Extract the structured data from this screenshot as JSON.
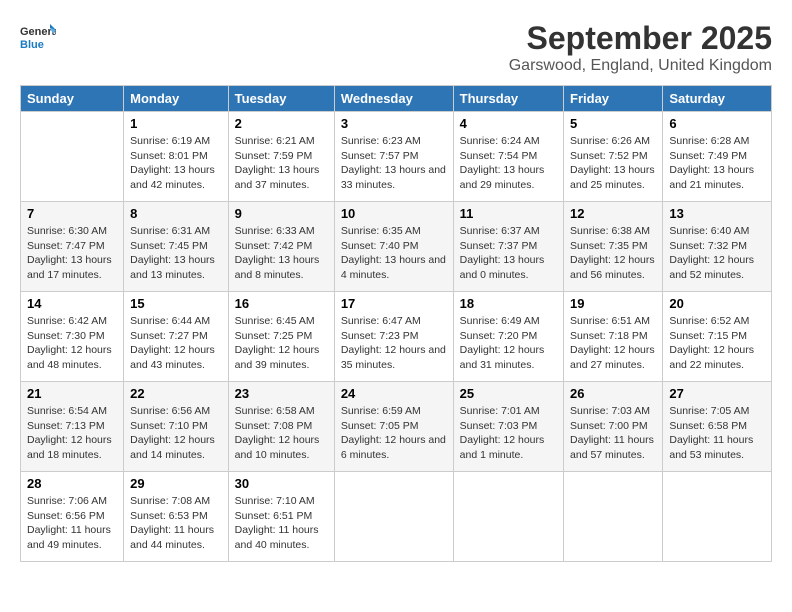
{
  "logo": {
    "line1": "General",
    "line2": "Blue"
  },
  "title": "September 2025",
  "location": "Garswood, England, United Kingdom",
  "headers": [
    "Sunday",
    "Monday",
    "Tuesday",
    "Wednesday",
    "Thursday",
    "Friday",
    "Saturday"
  ],
  "weeks": [
    [
      {
        "day": "",
        "sunrise": "",
        "sunset": "",
        "daylight": ""
      },
      {
        "day": "1",
        "sunrise": "Sunrise: 6:19 AM",
        "sunset": "Sunset: 8:01 PM",
        "daylight": "Daylight: 13 hours and 42 minutes."
      },
      {
        "day": "2",
        "sunrise": "Sunrise: 6:21 AM",
        "sunset": "Sunset: 7:59 PM",
        "daylight": "Daylight: 13 hours and 37 minutes."
      },
      {
        "day": "3",
        "sunrise": "Sunrise: 6:23 AM",
        "sunset": "Sunset: 7:57 PM",
        "daylight": "Daylight: 13 hours and 33 minutes."
      },
      {
        "day": "4",
        "sunrise": "Sunrise: 6:24 AM",
        "sunset": "Sunset: 7:54 PM",
        "daylight": "Daylight: 13 hours and 29 minutes."
      },
      {
        "day": "5",
        "sunrise": "Sunrise: 6:26 AM",
        "sunset": "Sunset: 7:52 PM",
        "daylight": "Daylight: 13 hours and 25 minutes."
      },
      {
        "day": "6",
        "sunrise": "Sunrise: 6:28 AM",
        "sunset": "Sunset: 7:49 PM",
        "daylight": "Daylight: 13 hours and 21 minutes."
      }
    ],
    [
      {
        "day": "7",
        "sunrise": "Sunrise: 6:30 AM",
        "sunset": "Sunset: 7:47 PM",
        "daylight": "Daylight: 13 hours and 17 minutes."
      },
      {
        "day": "8",
        "sunrise": "Sunrise: 6:31 AM",
        "sunset": "Sunset: 7:45 PM",
        "daylight": "Daylight: 13 hours and 13 minutes."
      },
      {
        "day": "9",
        "sunrise": "Sunrise: 6:33 AM",
        "sunset": "Sunset: 7:42 PM",
        "daylight": "Daylight: 13 hours and 8 minutes."
      },
      {
        "day": "10",
        "sunrise": "Sunrise: 6:35 AM",
        "sunset": "Sunset: 7:40 PM",
        "daylight": "Daylight: 13 hours and 4 minutes."
      },
      {
        "day": "11",
        "sunrise": "Sunrise: 6:37 AM",
        "sunset": "Sunset: 7:37 PM",
        "daylight": "Daylight: 13 hours and 0 minutes."
      },
      {
        "day": "12",
        "sunrise": "Sunrise: 6:38 AM",
        "sunset": "Sunset: 7:35 PM",
        "daylight": "Daylight: 12 hours and 56 minutes."
      },
      {
        "day": "13",
        "sunrise": "Sunrise: 6:40 AM",
        "sunset": "Sunset: 7:32 PM",
        "daylight": "Daylight: 12 hours and 52 minutes."
      }
    ],
    [
      {
        "day": "14",
        "sunrise": "Sunrise: 6:42 AM",
        "sunset": "Sunset: 7:30 PM",
        "daylight": "Daylight: 12 hours and 48 minutes."
      },
      {
        "day": "15",
        "sunrise": "Sunrise: 6:44 AM",
        "sunset": "Sunset: 7:27 PM",
        "daylight": "Daylight: 12 hours and 43 minutes."
      },
      {
        "day": "16",
        "sunrise": "Sunrise: 6:45 AM",
        "sunset": "Sunset: 7:25 PM",
        "daylight": "Daylight: 12 hours and 39 minutes."
      },
      {
        "day": "17",
        "sunrise": "Sunrise: 6:47 AM",
        "sunset": "Sunset: 7:23 PM",
        "daylight": "Daylight: 12 hours and 35 minutes."
      },
      {
        "day": "18",
        "sunrise": "Sunrise: 6:49 AM",
        "sunset": "Sunset: 7:20 PM",
        "daylight": "Daylight: 12 hours and 31 minutes."
      },
      {
        "day": "19",
        "sunrise": "Sunrise: 6:51 AM",
        "sunset": "Sunset: 7:18 PM",
        "daylight": "Daylight: 12 hours and 27 minutes."
      },
      {
        "day": "20",
        "sunrise": "Sunrise: 6:52 AM",
        "sunset": "Sunset: 7:15 PM",
        "daylight": "Daylight: 12 hours and 22 minutes."
      }
    ],
    [
      {
        "day": "21",
        "sunrise": "Sunrise: 6:54 AM",
        "sunset": "Sunset: 7:13 PM",
        "daylight": "Daylight: 12 hours and 18 minutes."
      },
      {
        "day": "22",
        "sunrise": "Sunrise: 6:56 AM",
        "sunset": "Sunset: 7:10 PM",
        "daylight": "Daylight: 12 hours and 14 minutes."
      },
      {
        "day": "23",
        "sunrise": "Sunrise: 6:58 AM",
        "sunset": "Sunset: 7:08 PM",
        "daylight": "Daylight: 12 hours and 10 minutes."
      },
      {
        "day": "24",
        "sunrise": "Sunrise: 6:59 AM",
        "sunset": "Sunset: 7:05 PM",
        "daylight": "Daylight: 12 hours and 6 minutes."
      },
      {
        "day": "25",
        "sunrise": "Sunrise: 7:01 AM",
        "sunset": "Sunset: 7:03 PM",
        "daylight": "Daylight: 12 hours and 1 minute."
      },
      {
        "day": "26",
        "sunrise": "Sunrise: 7:03 AM",
        "sunset": "Sunset: 7:00 PM",
        "daylight": "Daylight: 11 hours and 57 minutes."
      },
      {
        "day": "27",
        "sunrise": "Sunrise: 7:05 AM",
        "sunset": "Sunset: 6:58 PM",
        "daylight": "Daylight: 11 hours and 53 minutes."
      }
    ],
    [
      {
        "day": "28",
        "sunrise": "Sunrise: 7:06 AM",
        "sunset": "Sunset: 6:56 PM",
        "daylight": "Daylight: 11 hours and 49 minutes."
      },
      {
        "day": "29",
        "sunrise": "Sunrise: 7:08 AM",
        "sunset": "Sunset: 6:53 PM",
        "daylight": "Daylight: 11 hours and 44 minutes."
      },
      {
        "day": "30",
        "sunrise": "Sunrise: 7:10 AM",
        "sunset": "Sunset: 6:51 PM",
        "daylight": "Daylight: 11 hours and 40 minutes."
      },
      {
        "day": "",
        "sunrise": "",
        "sunset": "",
        "daylight": ""
      },
      {
        "day": "",
        "sunrise": "",
        "sunset": "",
        "daylight": ""
      },
      {
        "day": "",
        "sunrise": "",
        "sunset": "",
        "daylight": ""
      },
      {
        "day": "",
        "sunrise": "",
        "sunset": "",
        "daylight": ""
      }
    ]
  ]
}
